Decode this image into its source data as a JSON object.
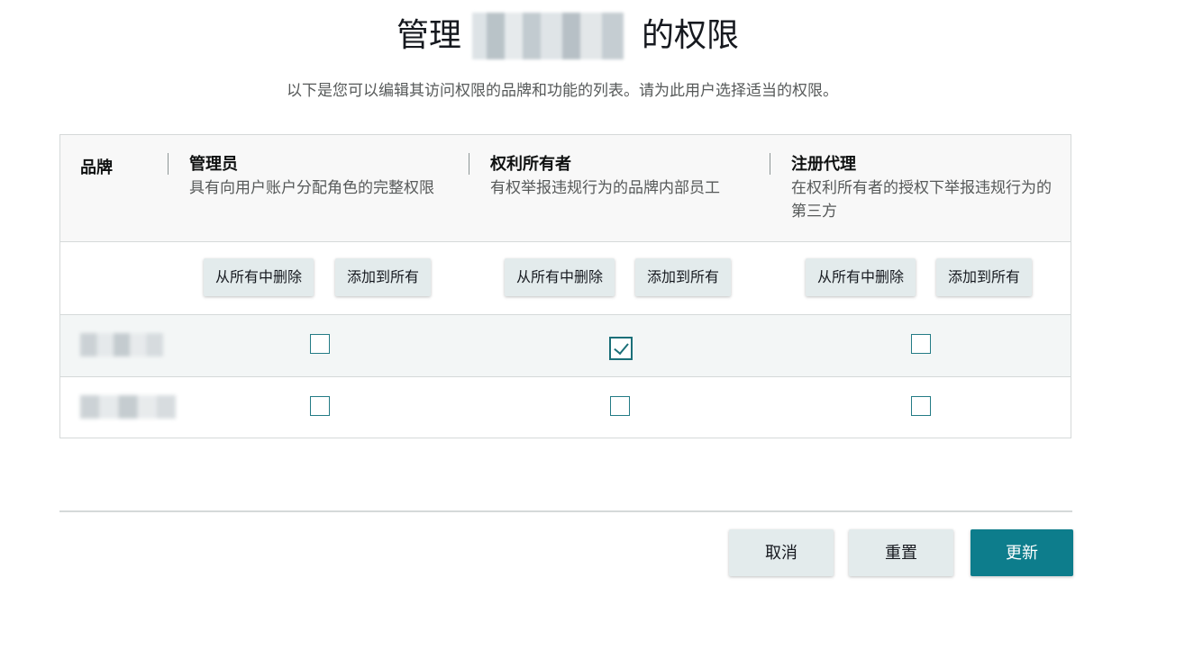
{
  "header": {
    "title_prefix": "管理",
    "title_suffix": "的权限",
    "subtitle": "以下是您可以编辑其访问权限的品牌和功能的列表。请为此用户选择适当的权限。"
  },
  "table": {
    "brand_column_label": "品牌",
    "roles": [
      {
        "name": "管理员",
        "description": "具有向用户账户分配角色的完整权限"
      },
      {
        "name": "权利所有者",
        "description": "有权举报违规行为的品牌内部员工"
      },
      {
        "name": "注册代理",
        "description": "在权利所有者的授权下举报违规行为的第三方"
      }
    ],
    "remove_all_label": "从所有中删除",
    "add_all_label": "添加到所有",
    "rows": [
      {
        "brand": "",
        "checked": [
          false,
          true,
          false
        ]
      },
      {
        "brand": "",
        "checked": [
          false,
          false,
          false
        ]
      }
    ]
  },
  "footer": {
    "cancel_label": "取消",
    "reset_label": "重置",
    "update_label": "更新"
  },
  "colors": {
    "accent": "#0d7d8c",
    "secondary_button": "#e3ebec",
    "header_bg": "#f8f8f8",
    "row_alt_bg": "#f3f6f6"
  }
}
